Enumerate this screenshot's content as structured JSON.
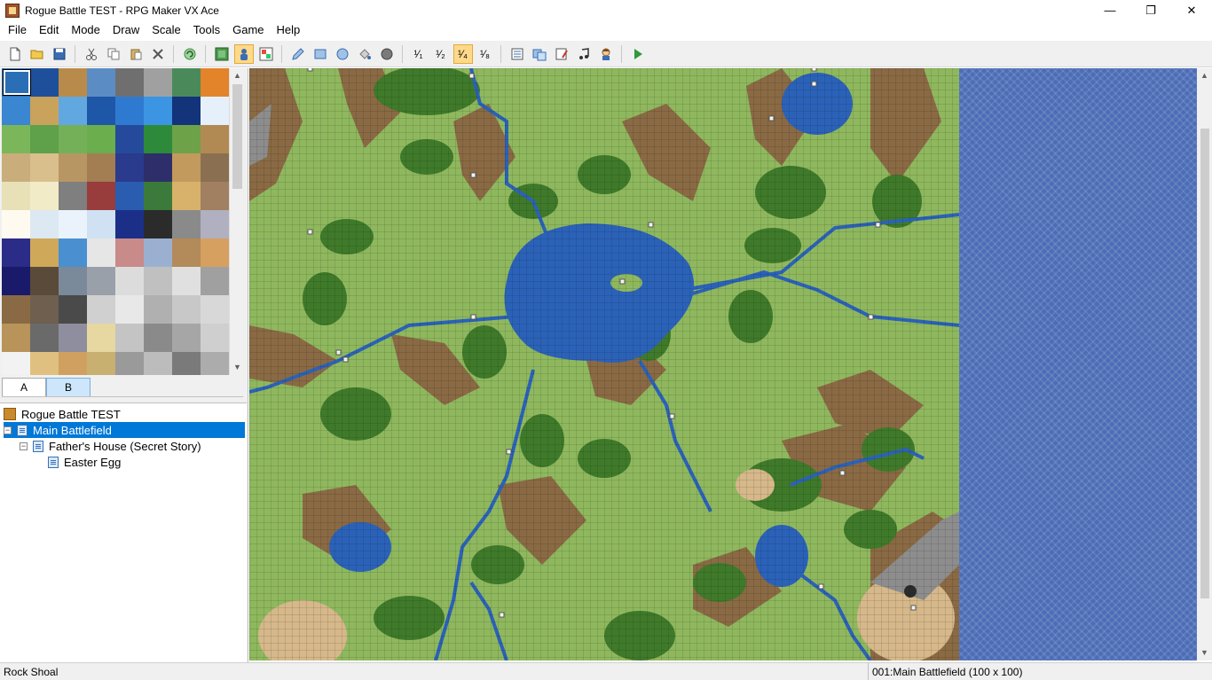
{
  "window": {
    "title": "Rogue Battle TEST - RPG Maker VX Ace",
    "minimize_glyph": "—",
    "maximize_glyph": "❐",
    "close_glyph": "✕"
  },
  "menu": {
    "items": [
      "File",
      "Edit",
      "Mode",
      "Draw",
      "Scale",
      "Tools",
      "Game",
      "Help"
    ]
  },
  "toolbar": {
    "scale_labels": [
      "¹⁄₁",
      "¹⁄₂",
      "¹⁄₄",
      "¹⁄₈"
    ],
    "active_scale_index": 2
  },
  "tileset": {
    "tabs": [
      "A",
      "B"
    ],
    "selected_tab": 1
  },
  "map_tree": {
    "project": "Rogue Battle TEST",
    "items": [
      {
        "label": "Main Battlefield",
        "depth": 1,
        "selected": true,
        "expander": "⊟"
      },
      {
        "label": "Father's House (Secret Story)",
        "depth": 2,
        "selected": false,
        "expander": "⊟"
      },
      {
        "label": "Easter Egg",
        "depth": 3,
        "selected": false,
        "expander": ""
      }
    ]
  },
  "status": {
    "tile_name": "Rock Shoal",
    "map_info": "001:Main Battlefield (100 x 100)"
  },
  "colors": {
    "grass": "#8fb85e",
    "forest": "#3f7a2a",
    "dirt_ridge": "#8a6a44",
    "water": "#2b62b8",
    "sand": "#d6b88a",
    "outside": "#4b6cb6",
    "selection": "#0078d7",
    "active_tool": "#ffd98a"
  }
}
